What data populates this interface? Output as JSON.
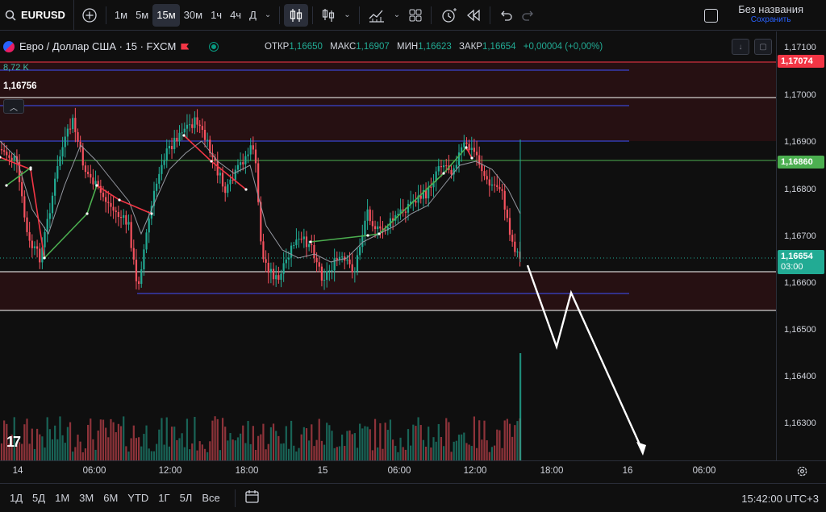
{
  "toolbar": {
    "symbol": "EURUSD",
    "intervals": [
      "1м",
      "5м",
      "15м",
      "30м",
      "1ч",
      "4ч",
      "Д"
    ],
    "active_interval": "15м",
    "layout_title": "Без названия",
    "layout_save": "Сохранить"
  },
  "legend": {
    "title": "Евро / Доллар США · 15 · FXCM",
    "open_label": "ОТКР",
    "open": "1,16650",
    "high_label": "МАКС",
    "high": "1,16907",
    "low_label": "МИН",
    "low": "1,16623",
    "close_label": "ЗАКР",
    "close": "1,16654",
    "change": "+0,00004 (+0,00%)",
    "indicator_value": "8,72 K",
    "level_value": "1,16756"
  },
  "price_scale": {
    "ticks": [
      "1,17100",
      "1,17000",
      "1,16900",
      "1,16800",
      "1,16700",
      "1,16600",
      "1,16500",
      "1,16400",
      "1,16300"
    ],
    "tag_red": "1,17074",
    "tag_green": "1,16860",
    "tag_current": "1,16654",
    "tag_countdown": "03:00",
    "colors": {
      "red": "#f23645",
      "green": "#4caf50",
      "current": "#22ab94"
    }
  },
  "time_axis": {
    "labels": [
      "14",
      "06:00",
      "12:00",
      "18:00",
      "15",
      "06:00",
      "12:00",
      "18:00",
      "16",
      "06:00"
    ]
  },
  "bottom": {
    "ranges": [
      "1Д",
      "5Д",
      "1М",
      "3М",
      "6М",
      "YTD",
      "1Г",
      "5Л",
      "Все"
    ],
    "clock": "15:42:00 UTC+3"
  },
  "colors": {
    "up": "#22ab94",
    "down": "#f7525f",
    "bg": "#0f0f0f"
  }
}
